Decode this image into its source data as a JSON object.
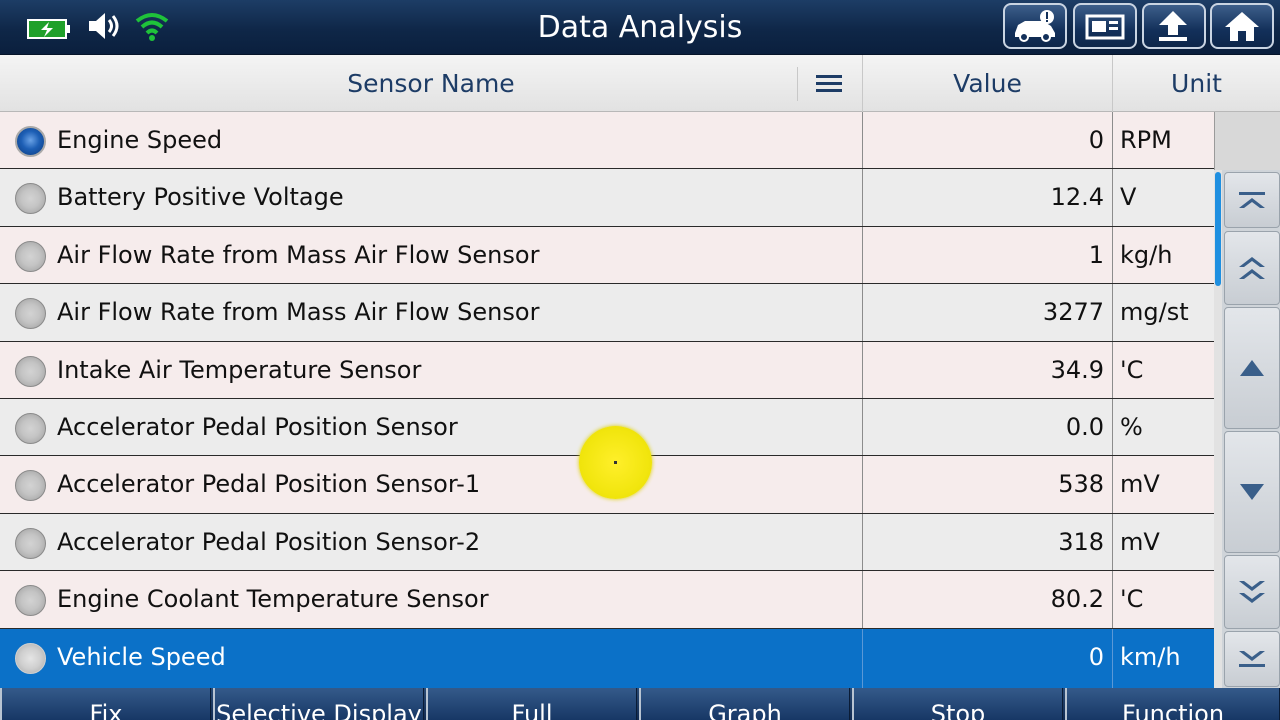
{
  "topbar": {
    "title": "Data Analysis",
    "status_icons": [
      "battery-charging-icon",
      "speaker-icon",
      "wifi-icon"
    ],
    "nav_buttons": [
      "car-info-icon",
      "print-screen-icon",
      "back-icon",
      "home-icon"
    ]
  },
  "header": {
    "sensor_name": "Sensor Name",
    "value": "Value",
    "unit": "Unit"
  },
  "rows": [
    {
      "name": "Engine Speed",
      "value": "0",
      "unit": "RPM",
      "selected": true
    },
    {
      "name": "Battery Positive Voltage",
      "value": "12.4",
      "unit": "V"
    },
    {
      "name": "Air Flow Rate from Mass Air Flow Sensor",
      "value": "1",
      "unit": "kg/h"
    },
    {
      "name": "Air Flow Rate from Mass Air Flow Sensor",
      "value": "3277",
      "unit": "mg/st"
    },
    {
      "name": "Intake Air Temperature Sensor",
      "value": "34.9",
      "unit": "'C"
    },
    {
      "name": "Accelerator Pedal Position Sensor",
      "value": "0.0",
      "unit": "%"
    },
    {
      "name": "Accelerator Pedal Position Sensor-1",
      "value": "538",
      "unit": "mV"
    },
    {
      "name": "Accelerator Pedal Position Sensor-2",
      "value": "318",
      "unit": "mV"
    },
    {
      "name": "Engine Coolant Temperature Sensor",
      "value": "80.2",
      "unit": "'C"
    },
    {
      "name": "Vehicle Speed",
      "value": "0",
      "unit": "km/h",
      "highlighted": true
    }
  ],
  "scroll": {
    "position": 0.0,
    "buttons": [
      "scroll-to-top-icon",
      "page-up-icon",
      "line-up-icon",
      "line-down-icon",
      "page-down-icon",
      "scroll-to-bottom-icon"
    ]
  },
  "bottombar": {
    "buttons": [
      "Fix",
      "Selective Display",
      "Full",
      "Graph",
      "Stop",
      "Function"
    ]
  },
  "colors": {
    "highlight_row": "#0b71c8",
    "header_text": "#1d3c66",
    "scroll_thumb": "#1f8fe0"
  }
}
